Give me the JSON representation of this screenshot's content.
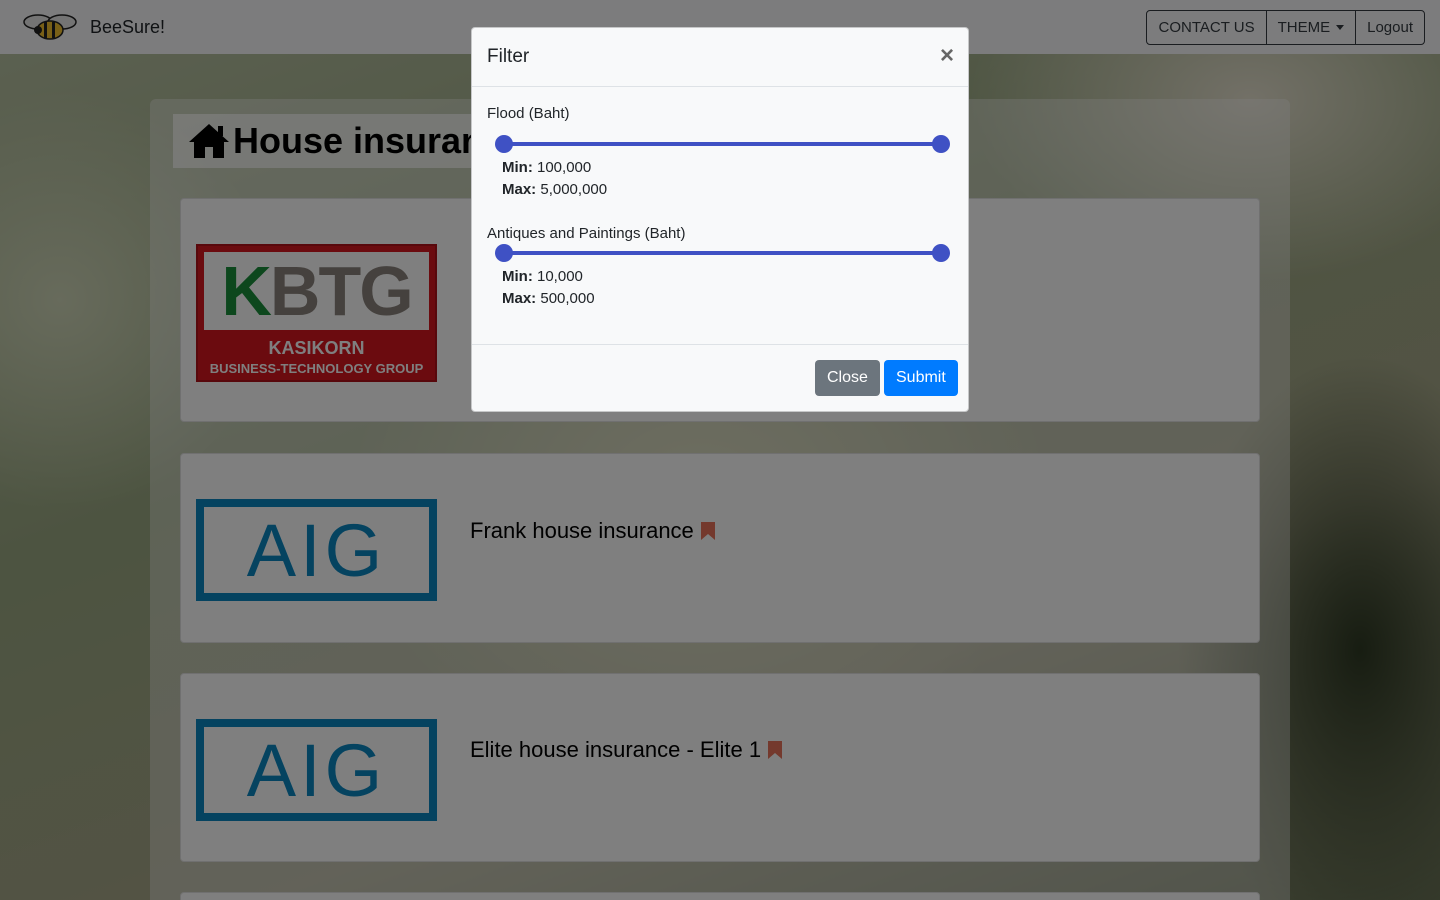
{
  "navbar": {
    "brand": "BeeSure!",
    "contact_label": "CONTACT US",
    "theme_label": "THEME",
    "logout_label": "Logout"
  },
  "page": {
    "title": "House insuran"
  },
  "cards": [
    {
      "logo": "KBTG",
      "logo_line1": "KASIKORN",
      "logo_line2": "BUSINESS-TECHNOLOGY GROUP",
      "title": ""
    },
    {
      "logo": "AIG",
      "title": "Frank house insurance"
    },
    {
      "logo": "AIG",
      "title": "Elite house insurance - Elite 1"
    }
  ],
  "modal": {
    "title": "Filter",
    "close_symbol": "×",
    "fields": [
      {
        "label": "Flood (Baht)",
        "min_label": "Min:",
        "min": "100,000",
        "max_label": "Max:",
        "max": "5,000,000"
      },
      {
        "label": "Antiques and Paintings (Baht)",
        "min_label": "Min:",
        "min": "10,000",
        "max_label": "Max:",
        "max": "500,000"
      }
    ],
    "close_button": "Close",
    "submit_button": "Submit"
  },
  "colors": {
    "primary": "#007bff",
    "secondary": "#6c757d",
    "slider": "#3f51c4",
    "bookmark": "#e8735a"
  },
  "icons": [
    "bee-logo-icon",
    "caret-down-icon",
    "home-icon",
    "bookmark-icon",
    "close-icon"
  ]
}
